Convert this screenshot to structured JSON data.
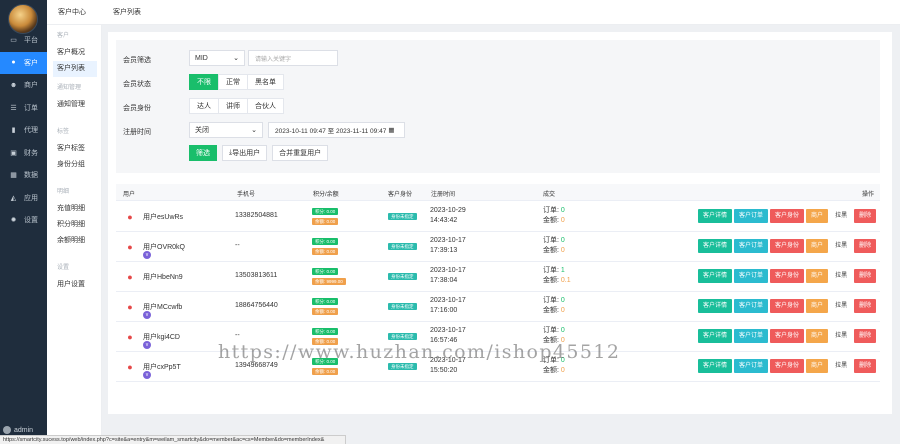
{
  "sidebar": {
    "items": [
      {
        "label": "平台",
        "icon": "monitor-icon"
      },
      {
        "label": "客户",
        "icon": "user-icon"
      },
      {
        "label": "商户",
        "icon": "users-icon"
      },
      {
        "label": "订单",
        "icon": "list-icon"
      },
      {
        "label": "代理",
        "icon": "book-icon"
      },
      {
        "label": "财务",
        "icon": "wallet-icon"
      },
      {
        "label": "数据",
        "icon": "calendar-icon"
      },
      {
        "label": "应用",
        "icon": "chart-icon"
      },
      {
        "label": "设置",
        "icon": "gear-icon"
      }
    ],
    "user": "admin"
  },
  "subnav": {
    "sections": [
      {
        "title": "客户",
        "items": [
          "客户概况",
          "客户列表"
        ]
      },
      {
        "title": "通知管理",
        "items": [
          "通知管理"
        ]
      },
      {
        "title": "标签",
        "items": [
          "客户标签",
          "身份分组"
        ]
      },
      {
        "title": "明细",
        "items": [
          "充值明细",
          "积分明细",
          "余额明细"
        ]
      },
      {
        "title": "设置",
        "items": [
          "用户设置"
        ]
      }
    ]
  },
  "header": {
    "crumb1": "客户中心",
    "crumb2": "客户列表"
  },
  "filter": {
    "member_label": "会员筛选",
    "member_select": "MID",
    "keyword_placeholder": "请输入关键字",
    "status_label": "会员状态",
    "status_options": [
      "不限",
      "正常",
      "黑名单"
    ],
    "identity_label": "会员身份",
    "identity_options": [
      "达人",
      "讲师",
      "合伙人"
    ],
    "time_label": "注册时间",
    "time_select": "关闭",
    "date_range": "2023-10-11 09:47 至 2023-11-11 09:47",
    "btn_filter": "筛选",
    "btn_export": "导出用户",
    "btn_merge": "合并重复用户"
  },
  "table": {
    "headers": [
      "用户",
      "手机号",
      "积分/余额",
      "客户身份",
      "注册时间",
      "成交",
      "操作"
    ],
    "rows": [
      {
        "name": "用户esUwRs",
        "vip": false,
        "phone": "13382504881",
        "points": "积分: 0.00",
        "balance": "余额: 0.00",
        "identity": "身份未指定",
        "date": "2023-10-29",
        "time": "14:43:42",
        "orders": "0",
        "amount": "0"
      },
      {
        "name": "用户OVR0kQ",
        "vip": true,
        "phone": "--",
        "points": "积分: 0.00",
        "balance": "余额: 0.00",
        "identity": "身份未指定",
        "date": "2023-10-17",
        "time": "17:39:13",
        "orders": "0",
        "amount": "0"
      },
      {
        "name": "用户HbeNn9",
        "vip": false,
        "phone": "13503813611",
        "points": "积分: 0.00",
        "balance": "余额: 9999.00",
        "identity": "身份未指定",
        "date": "2023-10-17",
        "time": "17:38:04",
        "orders": "1",
        "amount": "0.1"
      },
      {
        "name": "用户MCcwfb",
        "vip": true,
        "phone": "18864756440",
        "points": "积分: 0.00",
        "balance": "余额: 0.00",
        "identity": "身份未指定",
        "date": "2023-10-17",
        "time": "17:16:00",
        "orders": "0",
        "amount": "0"
      },
      {
        "name": "用户kgi4CD",
        "vip": true,
        "phone": "--",
        "points": "积分: 0.00",
        "balance": "余额: 0.00",
        "identity": "身份未指定",
        "date": "2023-10-17",
        "time": "16:57:46",
        "orders": "0",
        "amount": "0"
      },
      {
        "name": "用户cxPp5T",
        "vip": true,
        "phone": "13949668749",
        "points": "积分: 0.00",
        "balance": "余额: 0.00",
        "identity": "身份未指定",
        "date": "2023-10-17",
        "time": "15:50:20",
        "orders": "0",
        "amount": "0"
      }
    ],
    "order_label": "订单:",
    "amount_label": "金额:",
    "actions": [
      "客户详情",
      "客户订单",
      "客户身份",
      "商户",
      "拉黑",
      "删除"
    ]
  },
  "watermark": "https://www.huzhan.com/ishop45512",
  "statusbar": "https://smartcity.sucess.top/web/index.php?c=site&a=entry&m=weilam_smartcity&do=member&ac=cs=Member&do=memberIndex&"
}
